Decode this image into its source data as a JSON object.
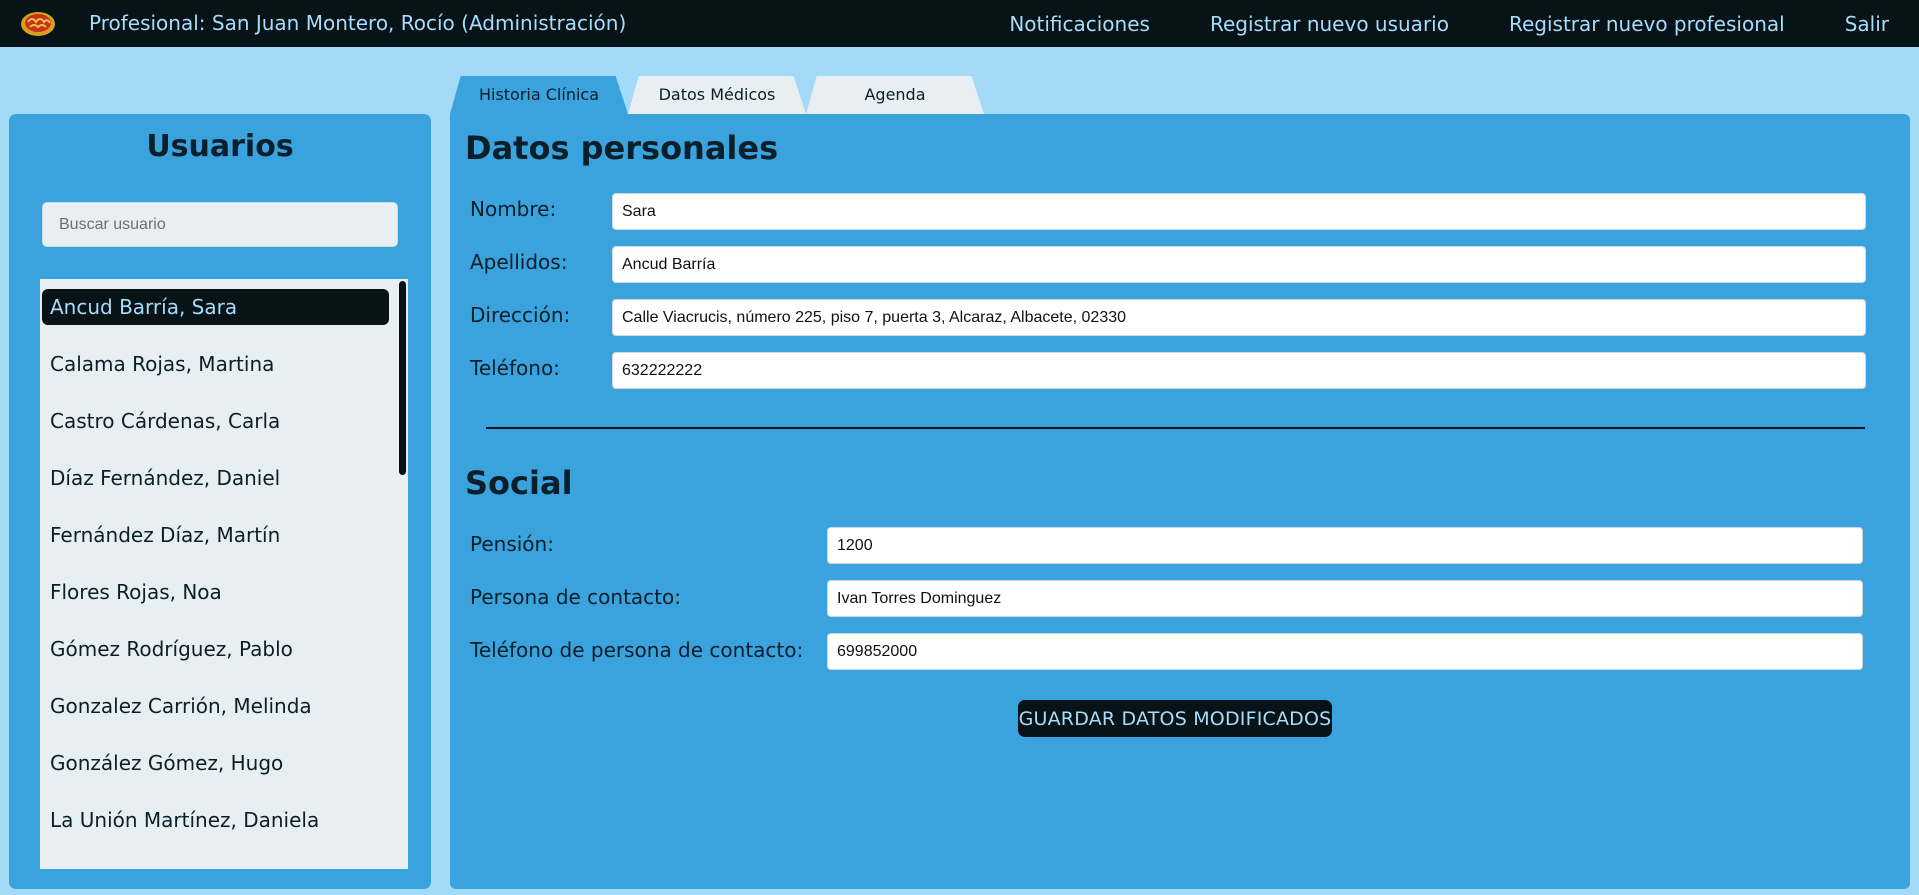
{
  "header": {
    "title": "Profesional: San Juan Montero, Rocío (Administración)",
    "nav": [
      "Notificaciones",
      "Registrar nuevo usuario",
      "Registrar nuevo profesional",
      "Salir"
    ]
  },
  "sidebar": {
    "title": "Usuarios",
    "search_placeholder": "Buscar usuario",
    "users": [
      "Ancud Barría, Sara",
      "Calama Rojas, Martina",
      "Castro Cárdenas, Carla",
      "Díaz Fernández, Daniel",
      "Fernández Díaz, Martín",
      "Flores Rojas, Noa",
      "Gómez Rodríguez, Pablo",
      "Gonzalez Carrión, Melinda",
      "González Gómez, Hugo",
      "La Unión Martínez, Daniela"
    ],
    "selected_index": 0
  },
  "tabs": [
    "Historia Clínica",
    "Datos Médicos",
    "Agenda"
  ],
  "active_tab": 0,
  "personal": {
    "title": "Datos personales",
    "nombre_label": "Nombre:",
    "nombre_value": "Sara",
    "apellidos_label": "Apellidos:",
    "apellidos_value": "Ancud Barría",
    "direccion_label": "Dirección:",
    "direccion_value": "Calle Viacrucis, número 225, piso 7, puerta 3, Alcaraz, Albacete, 02330",
    "telefono_label": "Teléfono:",
    "telefono_value": "632222222"
  },
  "social": {
    "title": "Social",
    "pension_label": "Pensión:",
    "pension_value": "1200",
    "contacto_label": "Persona de contacto:",
    "contacto_value": "Ivan Torres Dominguez",
    "tel_contacto_label": "Teléfono de persona de contacto:",
    "tel_contacto_value": "699852000"
  },
  "save_label": "GUARDAR DATOS MODIFICADOS",
  "colors": {
    "background": "#a3daf8",
    "panel": "#3aa2dc",
    "dark": "#071317",
    "accent_text": "#a7dcfb"
  }
}
